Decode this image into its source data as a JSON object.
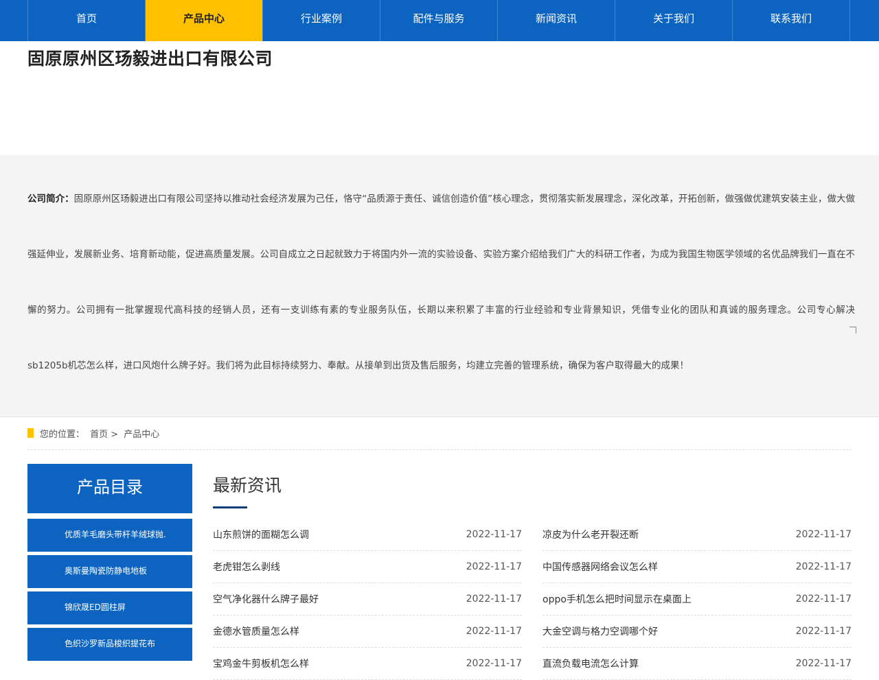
{
  "nav": {
    "items": [
      {
        "label": "首页"
      },
      {
        "label": "产品中心"
      },
      {
        "label": "行业案例"
      },
      {
        "label": "配件与服务"
      },
      {
        "label": "新闻资讯"
      },
      {
        "label": "关于我们"
      },
      {
        "label": "联系我们"
      }
    ],
    "active_index": 1
  },
  "company": {
    "title": "固原原州区玚毅进出口有限公司"
  },
  "intro": {
    "label": "公司简介：",
    "text": "固原原州区玚毅进出口有限公司坚持以推动社会经济发展为己任，恪守“品质源于责任、诚信创造价值”核心理念，贯彻落实新发展理念，深化改革，开拓创新，做强做优建筑安装主业，做大做强延伸业，发展新业务、培育新动能，促进高质量发展。公司自成立之日起就致力于将国内外一流的实验设备、实验方案介绍给我们广大的科研工作者，为成为我国生物医学领域的名优品牌我们一直在不懈的努力。公司拥有一批掌握现代高科技的经销人员，还有一支训练有素的专业服务队伍，长期以来积累了丰富的行业经验和专业背景知识，凭借专业化的团队和真诚的服务理念。公司专心解决sb1205b机芯怎么样，进口风炮什么牌子好。我们将为此目标持续努力、奉献。从接单到出货及售后服务，均建立完善的管理系统，确保为客户取得最大的成果！"
  },
  "breadcrumb": {
    "prefix": "您的位置：",
    "home": "首页",
    "separator": ">",
    "current": "产品中心"
  },
  "sidebar": {
    "title": "产品目录",
    "items": [
      {
        "label": "优质羊毛磨头带杆羊绒球抛."
      },
      {
        "label": "奥斯曼陶瓷防静电地板"
      },
      {
        "label": "锦欣晟ED圆柱屏"
      },
      {
        "label": "色织沙罗新品梭织提花布"
      }
    ]
  },
  "news": {
    "title": "最新资讯",
    "items": [
      {
        "title": "山东煎饼的面糊怎么调",
        "date": "2022-11-17"
      },
      {
        "title": "凉皮为什么老开裂还断",
        "date": "2022-11-17"
      },
      {
        "title": "老虎钳怎么剥线",
        "date": "2022-11-17"
      },
      {
        "title": "中国传感器网络会议怎么样",
        "date": "2022-11-17"
      },
      {
        "title": "空气净化器什么牌子最好",
        "date": "2022-11-17"
      },
      {
        "title": "oppo手机怎么把时间显示在桌面上",
        "date": "2022-11-17"
      },
      {
        "title": "金德水管质量怎么样",
        "date": "2022-11-17"
      },
      {
        "title": "大金空调与格力空调哪个好",
        "date": "2022-11-17"
      },
      {
        "title": "宝鸡金牛剪板机怎么样",
        "date": "2022-11-17"
      },
      {
        "title": "直流负载电流怎么计算",
        "date": "2022-11-17"
      }
    ]
  },
  "colors": {
    "primary": "#0c64c0",
    "accent": "#ffc000",
    "intro_bg": "#f4f4f4"
  }
}
